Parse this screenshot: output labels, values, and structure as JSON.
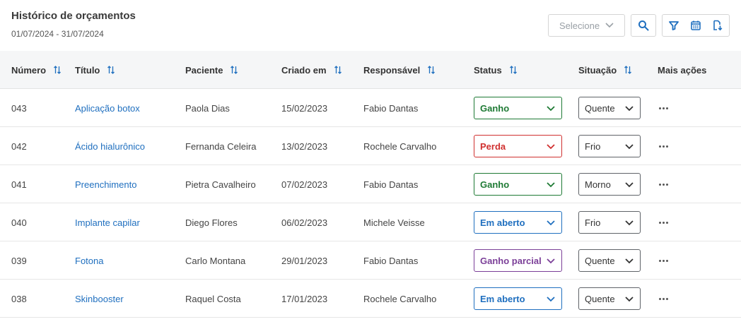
{
  "header": {
    "title": "Histórico de orçamentos",
    "date_range": "01/07/2024 - 31/07/2024",
    "select_placeholder": "Selecione",
    "icons": [
      "search-icon",
      "filter-icon",
      "calendar-icon",
      "export-icon"
    ]
  },
  "colors": {
    "link": "#1f6fbf",
    "ganho": "#1e7a34",
    "perda": "#d0302f",
    "em_aberto": "#1f6fbf",
    "ganho_parcial": "#7b3f98",
    "header_bg": "#f5f6f7"
  },
  "table": {
    "columns": [
      {
        "label": "Número"
      },
      {
        "label": "Título"
      },
      {
        "label": "Paciente"
      },
      {
        "label": "Criado em"
      },
      {
        "label": "Responsável"
      },
      {
        "label": "Status"
      },
      {
        "label": "Situação"
      },
      {
        "label": "Mais ações"
      }
    ],
    "rows": [
      {
        "numero": "043",
        "titulo": "Aplicação botox",
        "paciente": "Paola Dias",
        "criado_em": "15/02/2023",
        "responsavel": "Fabio Dantas",
        "status": "Ganho",
        "status_color": "#1e7a34",
        "situacao": "Quente"
      },
      {
        "numero": "042",
        "titulo": "Ácido hialurônico",
        "paciente": "Fernanda Celeira",
        "criado_em": "13/02/2023",
        "responsavel": "Rochele Carvalho",
        "status": "Perda",
        "status_color": "#d0302f",
        "situacao": "Frio"
      },
      {
        "numero": "041",
        "titulo": "Preenchimento",
        "paciente": "Pietra Cavalheiro",
        "criado_em": "07/02/2023",
        "responsavel": "Fabio Dantas",
        "status": "Ganho",
        "status_color": "#1e7a34",
        "situacao": "Morno"
      },
      {
        "numero": "040",
        "titulo": "Implante capilar",
        "paciente": "Diego Flores",
        "criado_em": "06/02/2023",
        "responsavel": "Michele Veisse",
        "status": "Em aberto",
        "status_color": "#1f6fbf",
        "situacao": "Frio"
      },
      {
        "numero": "039",
        "titulo": "Fotona",
        "paciente": "Carlo Montana",
        "criado_em": "29/01/2023",
        "responsavel": "Fabio Dantas",
        "status": "Ganho parcial",
        "status_color": "#7b3f98",
        "situacao": "Quente"
      },
      {
        "numero": "038",
        "titulo": "Skinbooster",
        "paciente": "Raquel Costa",
        "criado_em": "17/01/2023",
        "responsavel": "Rochele Carvalho",
        "status": "Em aberto",
        "status_color": "#1f6fbf",
        "situacao": "Quente"
      }
    ]
  }
}
